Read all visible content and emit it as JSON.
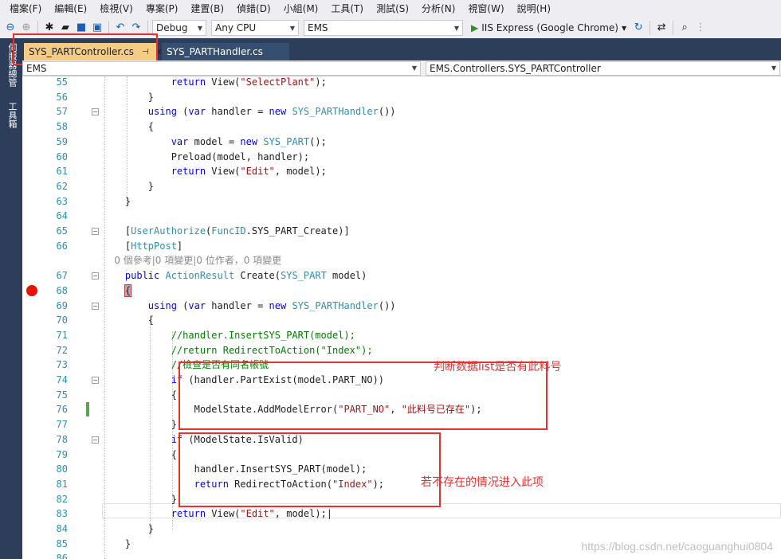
{
  "menu": {
    "items": [
      "檔案(F)",
      "編輯(E)",
      "檢視(V)",
      "專案(P)",
      "建置(B)",
      "偵錯(D)",
      "小組(M)",
      "工具(T)",
      "測試(S)",
      "分析(N)",
      "視窗(W)",
      "說明(H)"
    ]
  },
  "toolbar": {
    "config": "Debug",
    "platform": "Any CPU",
    "project": "EMS",
    "run_label": "IIS Express (Google Chrome)"
  },
  "sidebar": {
    "tab1": "伺服器總管",
    "tab2": "工具箱"
  },
  "tabs": {
    "active": "SYS_PARTController.cs",
    "inactive": "SYS_PARTHandler.cs"
  },
  "nav": {
    "left": "EMS",
    "right": "EMS.Controllers.SYS_PARTController"
  },
  "code": {
    "lines": [
      {
        "n": "55",
        "t": "            return View(\"SelectPlant\");"
      },
      {
        "n": "56",
        "t": "        }"
      },
      {
        "n": "57",
        "t": "        using (var handler = new SYS_PARTHandler())"
      },
      {
        "n": "58",
        "t": "        {"
      },
      {
        "n": "59",
        "t": "            var model = new SYS_PART();"
      },
      {
        "n": "60",
        "t": "            Preload(model, handler);"
      },
      {
        "n": "61",
        "t": "            return View(\"Edit\", model);"
      },
      {
        "n": "62",
        "t": "        }"
      },
      {
        "n": "63",
        "t": "    }"
      },
      {
        "n": "64",
        "t": ""
      },
      {
        "n": "65",
        "t": "    [UserAuthorize(FuncID.SYS_PART_Create)]"
      },
      {
        "n": "66",
        "t": "    [HttpPost]"
      },
      {
        "n": "",
        "t": "    0 個參考|0 項變更|0 位作者，0 項變更"
      },
      {
        "n": "67",
        "t": "    public ActionResult Create(SYS_PART model)"
      },
      {
        "n": "68",
        "t": "    {"
      },
      {
        "n": "69",
        "t": "        using (var handler = new SYS_PARTHandler())"
      },
      {
        "n": "70",
        "t": "        {"
      },
      {
        "n": "71",
        "t": "            //handler.InsertSYS_PART(model);"
      },
      {
        "n": "72",
        "t": "            //return RedirectToAction(\"Index\");"
      },
      {
        "n": "73",
        "t": "            //檢查是否有同名帳號"
      },
      {
        "n": "74",
        "t": "            if (handler.PartExist(model.PART_NO))"
      },
      {
        "n": "75",
        "t": "            {"
      },
      {
        "n": "76",
        "t": "                ModelState.AddModelError(\"PART_NO\", \"此料号已存在\");"
      },
      {
        "n": "77",
        "t": "            }"
      },
      {
        "n": "78",
        "t": "            if (ModelState.IsValid)"
      },
      {
        "n": "79",
        "t": "            {"
      },
      {
        "n": "80",
        "t": "                handler.InsertSYS_PART(model);"
      },
      {
        "n": "81",
        "t": "                return RedirectToAction(\"Index\");"
      },
      {
        "n": "82",
        "t": "            }"
      },
      {
        "n": "83",
        "t": "            return View(\"Edit\", model);"
      },
      {
        "n": "84",
        "t": "        }"
      },
      {
        "n": "85",
        "t": "    }"
      },
      {
        "n": "86",
        "t": ""
      }
    ]
  },
  "annotations": {
    "box1": "判断数据list是否有此料号",
    "box2": "若不存在的情况进入此项"
  },
  "watermark": "https://blog.csdn.net/caoguanghui0804",
  "colors": {
    "keyword": "#0000ff",
    "type": "#2b91af",
    "string": "#a31515",
    "comment": "#008000",
    "annotation": "#e8312f",
    "tab_active": "#f5cc84",
    "chrome_dark": "#2d3e5a"
  }
}
